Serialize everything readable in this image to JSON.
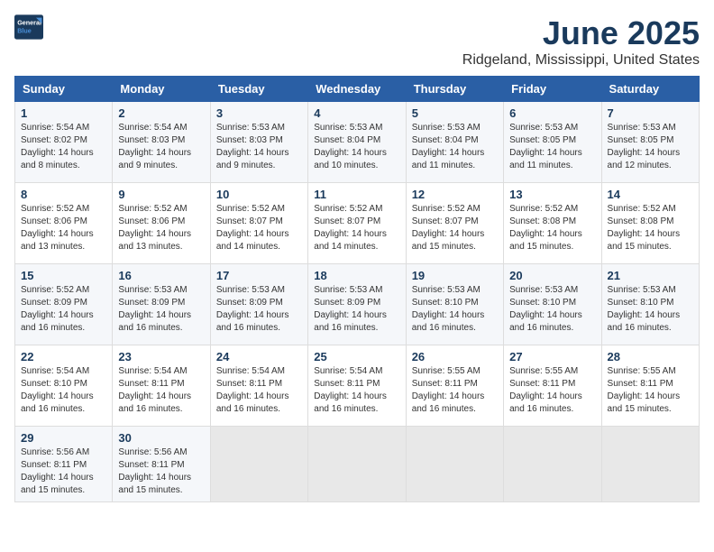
{
  "logo": {
    "text_general": "General",
    "text_blue": "Blue"
  },
  "title": "June 2025",
  "subtitle": "Ridgeland, Mississippi, United States",
  "days_of_week": [
    "Sunday",
    "Monday",
    "Tuesday",
    "Wednesday",
    "Thursday",
    "Friday",
    "Saturday"
  ],
  "weeks": [
    [
      {
        "day": "1",
        "detail": "Sunrise: 5:54 AM\nSunset: 8:02 PM\nDaylight: 14 hours\nand 8 minutes."
      },
      {
        "day": "2",
        "detail": "Sunrise: 5:54 AM\nSunset: 8:03 PM\nDaylight: 14 hours\nand 9 minutes."
      },
      {
        "day": "3",
        "detail": "Sunrise: 5:53 AM\nSunset: 8:03 PM\nDaylight: 14 hours\nand 9 minutes."
      },
      {
        "day": "4",
        "detail": "Sunrise: 5:53 AM\nSunset: 8:04 PM\nDaylight: 14 hours\nand 10 minutes."
      },
      {
        "day": "5",
        "detail": "Sunrise: 5:53 AM\nSunset: 8:04 PM\nDaylight: 14 hours\nand 11 minutes."
      },
      {
        "day": "6",
        "detail": "Sunrise: 5:53 AM\nSunset: 8:05 PM\nDaylight: 14 hours\nand 11 minutes."
      },
      {
        "day": "7",
        "detail": "Sunrise: 5:53 AM\nSunset: 8:05 PM\nDaylight: 14 hours\nand 12 minutes."
      }
    ],
    [
      {
        "day": "8",
        "detail": "Sunrise: 5:52 AM\nSunset: 8:06 PM\nDaylight: 14 hours\nand 13 minutes."
      },
      {
        "day": "9",
        "detail": "Sunrise: 5:52 AM\nSunset: 8:06 PM\nDaylight: 14 hours\nand 13 minutes."
      },
      {
        "day": "10",
        "detail": "Sunrise: 5:52 AM\nSunset: 8:07 PM\nDaylight: 14 hours\nand 14 minutes."
      },
      {
        "day": "11",
        "detail": "Sunrise: 5:52 AM\nSunset: 8:07 PM\nDaylight: 14 hours\nand 14 minutes."
      },
      {
        "day": "12",
        "detail": "Sunrise: 5:52 AM\nSunset: 8:07 PM\nDaylight: 14 hours\nand 15 minutes."
      },
      {
        "day": "13",
        "detail": "Sunrise: 5:52 AM\nSunset: 8:08 PM\nDaylight: 14 hours\nand 15 minutes."
      },
      {
        "day": "14",
        "detail": "Sunrise: 5:52 AM\nSunset: 8:08 PM\nDaylight: 14 hours\nand 15 minutes."
      }
    ],
    [
      {
        "day": "15",
        "detail": "Sunrise: 5:52 AM\nSunset: 8:09 PM\nDaylight: 14 hours\nand 16 minutes."
      },
      {
        "day": "16",
        "detail": "Sunrise: 5:53 AM\nSunset: 8:09 PM\nDaylight: 14 hours\nand 16 minutes."
      },
      {
        "day": "17",
        "detail": "Sunrise: 5:53 AM\nSunset: 8:09 PM\nDaylight: 14 hours\nand 16 minutes."
      },
      {
        "day": "18",
        "detail": "Sunrise: 5:53 AM\nSunset: 8:09 PM\nDaylight: 14 hours\nand 16 minutes."
      },
      {
        "day": "19",
        "detail": "Sunrise: 5:53 AM\nSunset: 8:10 PM\nDaylight: 14 hours\nand 16 minutes."
      },
      {
        "day": "20",
        "detail": "Sunrise: 5:53 AM\nSunset: 8:10 PM\nDaylight: 14 hours\nand 16 minutes."
      },
      {
        "day": "21",
        "detail": "Sunrise: 5:53 AM\nSunset: 8:10 PM\nDaylight: 14 hours\nand 16 minutes."
      }
    ],
    [
      {
        "day": "22",
        "detail": "Sunrise: 5:54 AM\nSunset: 8:10 PM\nDaylight: 14 hours\nand 16 minutes."
      },
      {
        "day": "23",
        "detail": "Sunrise: 5:54 AM\nSunset: 8:11 PM\nDaylight: 14 hours\nand 16 minutes."
      },
      {
        "day": "24",
        "detail": "Sunrise: 5:54 AM\nSunset: 8:11 PM\nDaylight: 14 hours\nand 16 minutes."
      },
      {
        "day": "25",
        "detail": "Sunrise: 5:54 AM\nSunset: 8:11 PM\nDaylight: 14 hours\nand 16 minutes."
      },
      {
        "day": "26",
        "detail": "Sunrise: 5:55 AM\nSunset: 8:11 PM\nDaylight: 14 hours\nand 16 minutes."
      },
      {
        "day": "27",
        "detail": "Sunrise: 5:55 AM\nSunset: 8:11 PM\nDaylight: 14 hours\nand 16 minutes."
      },
      {
        "day": "28",
        "detail": "Sunrise: 5:55 AM\nSunset: 8:11 PM\nDaylight: 14 hours\nand 15 minutes."
      }
    ],
    [
      {
        "day": "29",
        "detail": "Sunrise: 5:56 AM\nSunset: 8:11 PM\nDaylight: 14 hours\nand 15 minutes."
      },
      {
        "day": "30",
        "detail": "Sunrise: 5:56 AM\nSunset: 8:11 PM\nDaylight: 14 hours\nand 15 minutes."
      },
      {
        "day": "",
        "detail": ""
      },
      {
        "day": "",
        "detail": ""
      },
      {
        "day": "",
        "detail": ""
      },
      {
        "day": "",
        "detail": ""
      },
      {
        "day": "",
        "detail": ""
      }
    ]
  ]
}
